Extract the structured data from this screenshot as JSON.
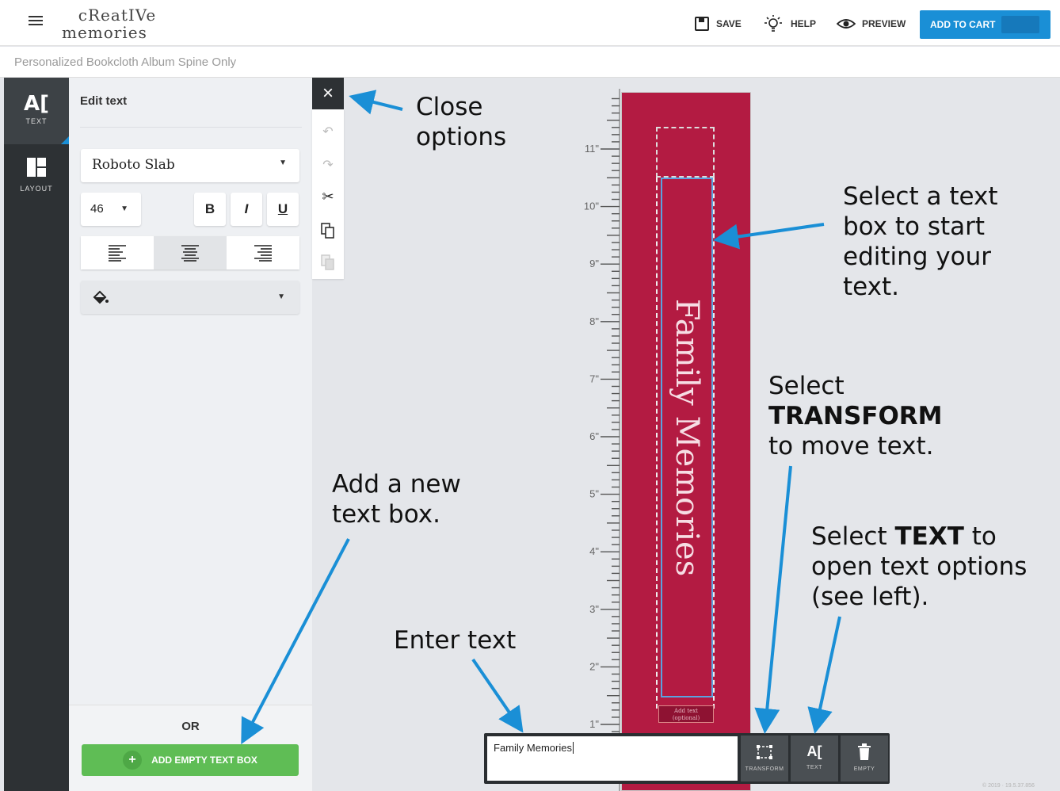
{
  "header": {
    "menu_icon": "hamburger-icon",
    "logo_line1": "cReatIVe",
    "logo_line2": "memories",
    "save_label": "SAVE",
    "help_label": "HELP",
    "preview_label": "PREVIEW",
    "cart_label": "ADD TO CART",
    "cart_price": "$",
    "accent": "#1a8fd6"
  },
  "subheader": {
    "title": "Personalized Bookcloth Album Spine Only"
  },
  "rail": {
    "items": [
      {
        "icon": "text-icon",
        "glyph": "A[",
        "label": "TEXT"
      },
      {
        "icon": "layout-icon",
        "glyph": "▦",
        "label": "LAYOUT"
      }
    ]
  },
  "panel": {
    "title": "Edit text",
    "font_family_value": "Roboto Slab",
    "font_size_value": "46",
    "bold_label": "B",
    "italic_label": "I",
    "underline_label": "U",
    "or_label": "OR",
    "add_button_label": "ADD EMPTY TEXT BOX"
  },
  "toolbar": {
    "close_glyph": "×"
  },
  "canvas": {
    "ruler_labels": [
      "11\"",
      "10\"",
      "9\"",
      "8\"",
      "7\"",
      "6\"",
      "5\"",
      "4\"",
      "3\"",
      "2\"",
      "1\""
    ],
    "spine_color": "#b31b42",
    "spine_text": "Family Memories",
    "add_text_line1": "Add text",
    "add_text_line2": "(optional)"
  },
  "entry_bar": {
    "input_value": "Family Memories",
    "transform_label": "TRANSFORM",
    "text_label": "TEXT",
    "empty_label": "EMPTY"
  },
  "annotations": {
    "close_1": "Close",
    "close_2": "options",
    "select_box_1": "Select a text",
    "select_box_2": "box to start",
    "select_box_3": "editing your",
    "select_box_4": "text.",
    "transform_1": "Select",
    "transform_2": "TRANSFORM",
    "transform_3": "to move text.",
    "add_new_1": "Add a new",
    "add_new_2": "text box.",
    "text_opt_1a": "Select ",
    "text_opt_1b": "TEXT",
    "text_opt_1c": " to",
    "text_opt_2": "open text options",
    "text_opt_3": "(see left).",
    "enter_text": "Enter text",
    "arrow_color": "#1a8fd6"
  },
  "copyright": "© 2019 · 19.5.37.856"
}
